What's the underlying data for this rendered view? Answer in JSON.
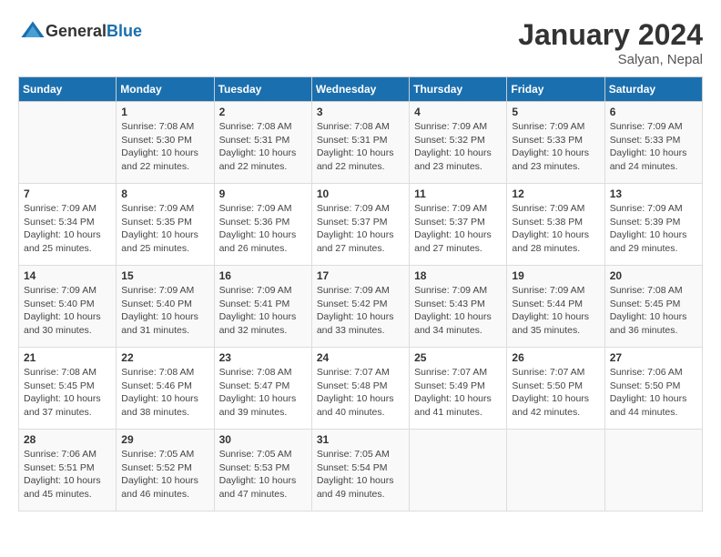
{
  "logo": {
    "general": "General",
    "blue": "Blue"
  },
  "title": "January 2024",
  "location": "Salyan, Nepal",
  "days_of_week": [
    "Sunday",
    "Monday",
    "Tuesday",
    "Wednesday",
    "Thursday",
    "Friday",
    "Saturday"
  ],
  "weeks": [
    [
      {
        "day": "",
        "info": ""
      },
      {
        "day": "1",
        "info": "Sunrise: 7:08 AM\nSunset: 5:30 PM\nDaylight: 10 hours\nand 22 minutes."
      },
      {
        "day": "2",
        "info": "Sunrise: 7:08 AM\nSunset: 5:31 PM\nDaylight: 10 hours\nand 22 minutes."
      },
      {
        "day": "3",
        "info": "Sunrise: 7:08 AM\nSunset: 5:31 PM\nDaylight: 10 hours\nand 22 minutes."
      },
      {
        "day": "4",
        "info": "Sunrise: 7:09 AM\nSunset: 5:32 PM\nDaylight: 10 hours\nand 23 minutes."
      },
      {
        "day": "5",
        "info": "Sunrise: 7:09 AM\nSunset: 5:33 PM\nDaylight: 10 hours\nand 23 minutes."
      },
      {
        "day": "6",
        "info": "Sunrise: 7:09 AM\nSunset: 5:33 PM\nDaylight: 10 hours\nand 24 minutes."
      }
    ],
    [
      {
        "day": "7",
        "info": "Sunrise: 7:09 AM\nSunset: 5:34 PM\nDaylight: 10 hours\nand 25 minutes."
      },
      {
        "day": "8",
        "info": "Sunrise: 7:09 AM\nSunset: 5:35 PM\nDaylight: 10 hours\nand 25 minutes."
      },
      {
        "day": "9",
        "info": "Sunrise: 7:09 AM\nSunset: 5:36 PM\nDaylight: 10 hours\nand 26 minutes."
      },
      {
        "day": "10",
        "info": "Sunrise: 7:09 AM\nSunset: 5:37 PM\nDaylight: 10 hours\nand 27 minutes."
      },
      {
        "day": "11",
        "info": "Sunrise: 7:09 AM\nSunset: 5:37 PM\nDaylight: 10 hours\nand 27 minutes."
      },
      {
        "day": "12",
        "info": "Sunrise: 7:09 AM\nSunset: 5:38 PM\nDaylight: 10 hours\nand 28 minutes."
      },
      {
        "day": "13",
        "info": "Sunrise: 7:09 AM\nSunset: 5:39 PM\nDaylight: 10 hours\nand 29 minutes."
      }
    ],
    [
      {
        "day": "14",
        "info": "Sunrise: 7:09 AM\nSunset: 5:40 PM\nDaylight: 10 hours\nand 30 minutes."
      },
      {
        "day": "15",
        "info": "Sunrise: 7:09 AM\nSunset: 5:40 PM\nDaylight: 10 hours\nand 31 minutes."
      },
      {
        "day": "16",
        "info": "Sunrise: 7:09 AM\nSunset: 5:41 PM\nDaylight: 10 hours\nand 32 minutes."
      },
      {
        "day": "17",
        "info": "Sunrise: 7:09 AM\nSunset: 5:42 PM\nDaylight: 10 hours\nand 33 minutes."
      },
      {
        "day": "18",
        "info": "Sunrise: 7:09 AM\nSunset: 5:43 PM\nDaylight: 10 hours\nand 34 minutes."
      },
      {
        "day": "19",
        "info": "Sunrise: 7:09 AM\nSunset: 5:44 PM\nDaylight: 10 hours\nand 35 minutes."
      },
      {
        "day": "20",
        "info": "Sunrise: 7:08 AM\nSunset: 5:45 PM\nDaylight: 10 hours\nand 36 minutes."
      }
    ],
    [
      {
        "day": "21",
        "info": "Sunrise: 7:08 AM\nSunset: 5:45 PM\nDaylight: 10 hours\nand 37 minutes."
      },
      {
        "day": "22",
        "info": "Sunrise: 7:08 AM\nSunset: 5:46 PM\nDaylight: 10 hours\nand 38 minutes."
      },
      {
        "day": "23",
        "info": "Sunrise: 7:08 AM\nSunset: 5:47 PM\nDaylight: 10 hours\nand 39 minutes."
      },
      {
        "day": "24",
        "info": "Sunrise: 7:07 AM\nSunset: 5:48 PM\nDaylight: 10 hours\nand 40 minutes."
      },
      {
        "day": "25",
        "info": "Sunrise: 7:07 AM\nSunset: 5:49 PM\nDaylight: 10 hours\nand 41 minutes."
      },
      {
        "day": "26",
        "info": "Sunrise: 7:07 AM\nSunset: 5:50 PM\nDaylight: 10 hours\nand 42 minutes."
      },
      {
        "day": "27",
        "info": "Sunrise: 7:06 AM\nSunset: 5:50 PM\nDaylight: 10 hours\nand 44 minutes."
      }
    ],
    [
      {
        "day": "28",
        "info": "Sunrise: 7:06 AM\nSunset: 5:51 PM\nDaylight: 10 hours\nand 45 minutes."
      },
      {
        "day": "29",
        "info": "Sunrise: 7:05 AM\nSunset: 5:52 PM\nDaylight: 10 hours\nand 46 minutes."
      },
      {
        "day": "30",
        "info": "Sunrise: 7:05 AM\nSunset: 5:53 PM\nDaylight: 10 hours\nand 47 minutes."
      },
      {
        "day": "31",
        "info": "Sunrise: 7:05 AM\nSunset: 5:54 PM\nDaylight: 10 hours\nand 49 minutes."
      },
      {
        "day": "",
        "info": ""
      },
      {
        "day": "",
        "info": ""
      },
      {
        "day": "",
        "info": ""
      }
    ]
  ]
}
